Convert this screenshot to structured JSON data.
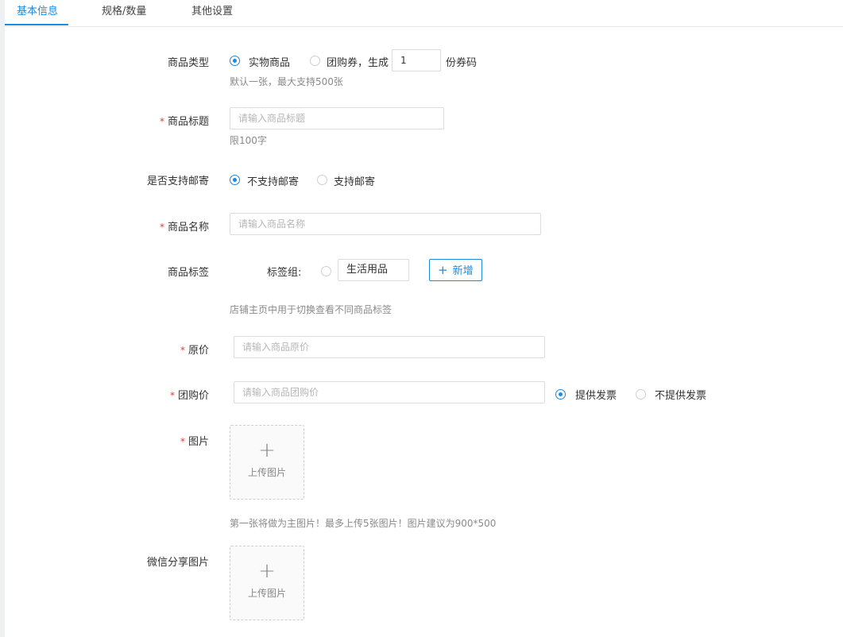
{
  "tabs": [
    {
      "label": "基本信息",
      "active": true
    },
    {
      "label": "规格/数量",
      "active": false
    },
    {
      "label": "其他设置",
      "active": false
    }
  ],
  "form": {
    "product_type": {
      "label": "商品类型",
      "option_physical": "实物商品",
      "option_voucher": "团购券，生成",
      "voucher_count": "1",
      "voucher_suffix": "份券码",
      "hint": "默认一张，最大支持500张",
      "selected": "实物商品"
    },
    "title": {
      "required_mark": "*",
      "label": "商品标题",
      "placeholder": "请输入商品标题",
      "hint": "限100字"
    },
    "shipping": {
      "label": "是否支持邮寄",
      "option_no": "不支持邮寄",
      "option_yes": "支持邮寄",
      "selected": "不支持邮寄"
    },
    "name": {
      "required_mark": "*",
      "label": "商品名称",
      "placeholder": "请输入商品名称"
    },
    "tags": {
      "label": "商品标签",
      "group_label": "标签组:",
      "tag_value": "生活用品",
      "add_button": "新增",
      "hint": "店铺主页中用于切换查看不同商品标签"
    },
    "original_price": {
      "required_mark": "*",
      "label": "原价",
      "placeholder": "请输入商品原价"
    },
    "group_price": {
      "required_mark": "*",
      "label": "团购价",
      "placeholder": "请输入商品团购价",
      "option_invoice": "提供发票",
      "option_no_invoice": "不提供发票",
      "selected": "提供发票"
    },
    "image": {
      "required_mark": "*",
      "label": "图片",
      "upload_text": "上传图片",
      "hint": "第一张将做为主图片！最多上传5张图片！图片建议为900*500"
    },
    "wechat_image": {
      "label": "微信分享图片",
      "upload_text": "上传图片"
    }
  },
  "colors": {
    "accent": "#1b8ae0",
    "required": "#e23b3b",
    "hint": "#8a8a8a"
  }
}
